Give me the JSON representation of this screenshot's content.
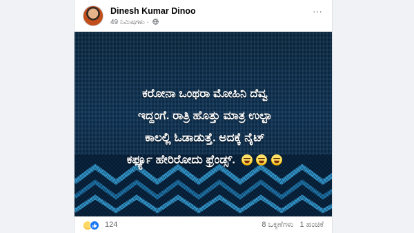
{
  "post": {
    "author": "Dinesh Kumar Dinoo",
    "time": "49 ನಿಮಿಷಗಳು",
    "separator": "·",
    "image_text": {
      "line1": "ಕರೋನಾ ಒಂಥರಾ ಮೋಹಿನಿ ದೆವ್ವ",
      "line2": "ಇದ್ದಂಗೆ. ರಾತ್ರಿ ಹೊತ್ತು ಮಾತ್ರ ಉಲ್ಟಾ",
      "line3": "ಕಾಲಲ್ಲಿ ಓಡಾಡುತ್ತೆ. ಅದಕ್ಕೆ ನೈಟ್",
      "line4": "ಕರ್ಫ್ಯೂ ಹೇರಿರೋದು ಫ್ರೆಂಡ್ಸ್."
    },
    "reactions_count": "124",
    "comments": "8 ಒಕ್ಕಣೆಗಳು",
    "shares": "1 ಹಂಚಿಕೆ"
  },
  "icons": {
    "more": "more-options-icon",
    "privacy": "globe-icon",
    "reaction1": "haha-reaction-icon",
    "reaction2": "like-reaction-icon",
    "emoji": "laughing-emoji-icon"
  },
  "colors": {
    "like_blue": "#1877f2",
    "image_bg": "#0f3558",
    "knit_accent": "#2f8fc4"
  }
}
